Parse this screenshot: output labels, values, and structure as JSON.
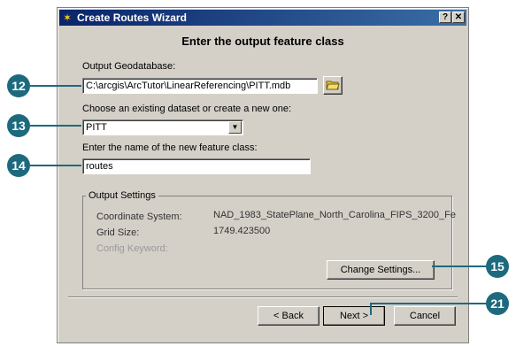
{
  "window": {
    "title": "Create Routes Wizard",
    "help_btn": "?",
    "close_btn": "✕"
  },
  "page": {
    "heading": "Enter the output feature class"
  },
  "geodatabase": {
    "label": "Output Geodatabase:",
    "value": "C:\\arcgis\\ArcTutor\\LinearReferencing\\PITT.mdb"
  },
  "dataset": {
    "label": "Choose an existing dataset or create a new one:",
    "value": "PITT"
  },
  "feature_class": {
    "label": "Enter the name of the new feature class:",
    "value": "routes"
  },
  "output_settings": {
    "legend": "Output Settings",
    "coord_label": "Coordinate System:",
    "coord_value": "NAD_1983_StatePlane_North_Carolina_FIPS_3200_Fe",
    "grid_label": "Grid Size:",
    "grid_value": "1749.423500",
    "config_label": "Config Keyword:",
    "change_button": "Change Settings..."
  },
  "footer": {
    "back": "< Back",
    "next": "Next >",
    "cancel": "Cancel"
  },
  "callouts": {
    "c12": "12",
    "c13": "13",
    "c14": "14",
    "c15": "15",
    "c21": "21"
  }
}
